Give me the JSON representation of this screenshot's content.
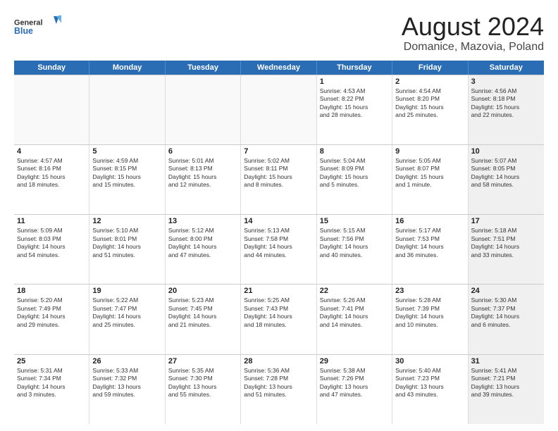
{
  "header": {
    "logo_line1": "General",
    "logo_line2": "Blue",
    "main_title": "August 2024",
    "subtitle": "Domanice, Mazovia, Poland"
  },
  "days_of_week": [
    "Sunday",
    "Monday",
    "Tuesday",
    "Wednesday",
    "Thursday",
    "Friday",
    "Saturday"
  ],
  "weeks": [
    [
      {
        "day": "",
        "info": "",
        "empty": true
      },
      {
        "day": "",
        "info": "",
        "empty": true
      },
      {
        "day": "",
        "info": "",
        "empty": true
      },
      {
        "day": "",
        "info": "",
        "empty": true
      },
      {
        "day": "1",
        "info": "Sunrise: 4:53 AM\nSunset: 8:22 PM\nDaylight: 15 hours\nand 28 minutes."
      },
      {
        "day": "2",
        "info": "Sunrise: 4:54 AM\nSunset: 8:20 PM\nDaylight: 15 hours\nand 25 minutes."
      },
      {
        "day": "3",
        "info": "Sunrise: 4:56 AM\nSunset: 8:18 PM\nDaylight: 15 hours\nand 22 minutes.",
        "shaded": true
      }
    ],
    [
      {
        "day": "4",
        "info": "Sunrise: 4:57 AM\nSunset: 8:16 PM\nDaylight: 15 hours\nand 18 minutes."
      },
      {
        "day": "5",
        "info": "Sunrise: 4:59 AM\nSunset: 8:15 PM\nDaylight: 15 hours\nand 15 minutes."
      },
      {
        "day": "6",
        "info": "Sunrise: 5:01 AM\nSunset: 8:13 PM\nDaylight: 15 hours\nand 12 minutes."
      },
      {
        "day": "7",
        "info": "Sunrise: 5:02 AM\nSunset: 8:11 PM\nDaylight: 15 hours\nand 8 minutes."
      },
      {
        "day": "8",
        "info": "Sunrise: 5:04 AM\nSunset: 8:09 PM\nDaylight: 15 hours\nand 5 minutes."
      },
      {
        "day": "9",
        "info": "Sunrise: 5:05 AM\nSunset: 8:07 PM\nDaylight: 15 hours\nand 1 minute."
      },
      {
        "day": "10",
        "info": "Sunrise: 5:07 AM\nSunset: 8:05 PM\nDaylight: 14 hours\nand 58 minutes.",
        "shaded": true
      }
    ],
    [
      {
        "day": "11",
        "info": "Sunrise: 5:09 AM\nSunset: 8:03 PM\nDaylight: 14 hours\nand 54 minutes."
      },
      {
        "day": "12",
        "info": "Sunrise: 5:10 AM\nSunset: 8:01 PM\nDaylight: 14 hours\nand 51 minutes."
      },
      {
        "day": "13",
        "info": "Sunrise: 5:12 AM\nSunset: 8:00 PM\nDaylight: 14 hours\nand 47 minutes."
      },
      {
        "day": "14",
        "info": "Sunrise: 5:13 AM\nSunset: 7:58 PM\nDaylight: 14 hours\nand 44 minutes."
      },
      {
        "day": "15",
        "info": "Sunrise: 5:15 AM\nSunset: 7:56 PM\nDaylight: 14 hours\nand 40 minutes."
      },
      {
        "day": "16",
        "info": "Sunrise: 5:17 AM\nSunset: 7:53 PM\nDaylight: 14 hours\nand 36 minutes."
      },
      {
        "day": "17",
        "info": "Sunrise: 5:18 AM\nSunset: 7:51 PM\nDaylight: 14 hours\nand 33 minutes.",
        "shaded": true
      }
    ],
    [
      {
        "day": "18",
        "info": "Sunrise: 5:20 AM\nSunset: 7:49 PM\nDaylight: 14 hours\nand 29 minutes."
      },
      {
        "day": "19",
        "info": "Sunrise: 5:22 AM\nSunset: 7:47 PM\nDaylight: 14 hours\nand 25 minutes."
      },
      {
        "day": "20",
        "info": "Sunrise: 5:23 AM\nSunset: 7:45 PM\nDaylight: 14 hours\nand 21 minutes."
      },
      {
        "day": "21",
        "info": "Sunrise: 5:25 AM\nSunset: 7:43 PM\nDaylight: 14 hours\nand 18 minutes."
      },
      {
        "day": "22",
        "info": "Sunrise: 5:26 AM\nSunset: 7:41 PM\nDaylight: 14 hours\nand 14 minutes."
      },
      {
        "day": "23",
        "info": "Sunrise: 5:28 AM\nSunset: 7:39 PM\nDaylight: 14 hours\nand 10 minutes."
      },
      {
        "day": "24",
        "info": "Sunrise: 5:30 AM\nSunset: 7:37 PM\nDaylight: 14 hours\nand 6 minutes.",
        "shaded": true
      }
    ],
    [
      {
        "day": "25",
        "info": "Sunrise: 5:31 AM\nSunset: 7:34 PM\nDaylight: 14 hours\nand 3 minutes."
      },
      {
        "day": "26",
        "info": "Sunrise: 5:33 AM\nSunset: 7:32 PM\nDaylight: 13 hours\nand 59 minutes."
      },
      {
        "day": "27",
        "info": "Sunrise: 5:35 AM\nSunset: 7:30 PM\nDaylight: 13 hours\nand 55 minutes."
      },
      {
        "day": "28",
        "info": "Sunrise: 5:36 AM\nSunset: 7:28 PM\nDaylight: 13 hours\nand 51 minutes."
      },
      {
        "day": "29",
        "info": "Sunrise: 5:38 AM\nSunset: 7:26 PM\nDaylight: 13 hours\nand 47 minutes."
      },
      {
        "day": "30",
        "info": "Sunrise: 5:40 AM\nSunset: 7:23 PM\nDaylight: 13 hours\nand 43 minutes."
      },
      {
        "day": "31",
        "info": "Sunrise: 5:41 AM\nSunset: 7:21 PM\nDaylight: 13 hours\nand 39 minutes.",
        "shaded": true
      }
    ]
  ]
}
